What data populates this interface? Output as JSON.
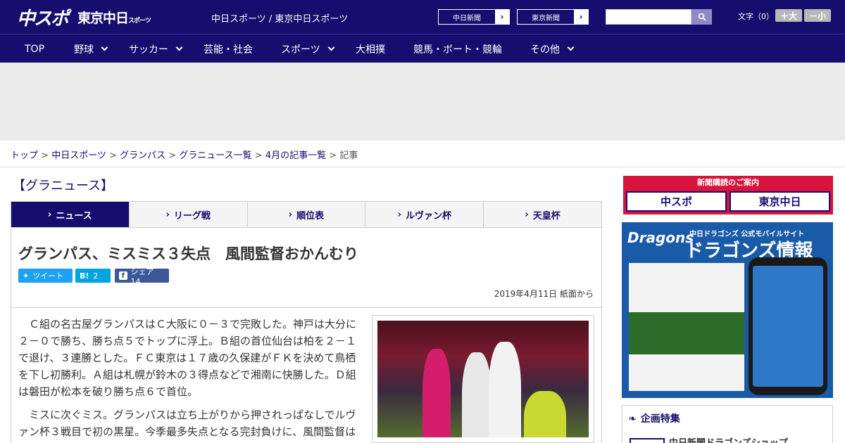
{
  "header": {
    "logo_main": "中スポ",
    "logo_sub": "東京中日",
    "logo_small": "スポーツ",
    "site_title": "中日スポーツ / 東京中日スポーツ",
    "btn1": "中日新聞",
    "btn2": "東京新聞",
    "search_placeholder": "",
    "font_label": "文字（0）",
    "font_up": "＋大",
    "font_down": "－小"
  },
  "nav": [
    "TOP",
    "野球",
    "サッカー",
    "芸能・社会",
    "スポーツ",
    "大相撲",
    "競馬・ボート・競輪",
    "その他"
  ],
  "breadcrumb": {
    "b1": "トップ",
    "b2": "中日スポーツ",
    "b3": "グランパス",
    "b4": "グラニュース一覧",
    "b5": "4月の記事一覧",
    "current": "記事",
    "sep": " > "
  },
  "section_title": "【グラニュース】",
  "tabs": [
    "ニュース",
    "リーグ戦",
    "順位表",
    "ルヴァン杯",
    "天皇杯"
  ],
  "article": {
    "title": "グランパス、ミスミス３失点　風間監督おかんむり",
    "tweet": "ツイート",
    "hatena": "2",
    "share": "シェア 14",
    "date": "2019年4月11日 紙面から",
    "p1": "　Ｃ組の名古屋グランパスはＣ大阪に０－３で完敗した。神戸は大分に２－０で勝ち、勝ち点５でトップに浮上。Ｂ組の首位仙台は柏を２－１で退け、３連勝とした。ＦＣ東京は１７歳の久保建がＦＫを決めて鳥栖を下し初勝利。Ａ組は札幌が鈴木の３得点などで湘南に快勝した。Ｄ組は磐田が松本を破り勝ち点６で首位。",
    "p2": "　ミスに次ぐミス。グランパスは立ち上がりから押されっぱなしでルヴァン杯３戦目で初の黒星。今季最多失点となる完封負けに、風間監督はお怒りモードだった。"
  },
  "side": {
    "subscribe": "新聞購読のご案内",
    "sub_a": "中スポ",
    "sub_b": "東京中日",
    "dragons_brand": "Dragons",
    "dragons_top": "中日ドラゴンズ 公式モバイルサイト",
    "dragons_title": "ドラゴンズ情報",
    "feature_title": "企画特集",
    "feature_item": "中日新聞ドラゴンズショップ"
  }
}
